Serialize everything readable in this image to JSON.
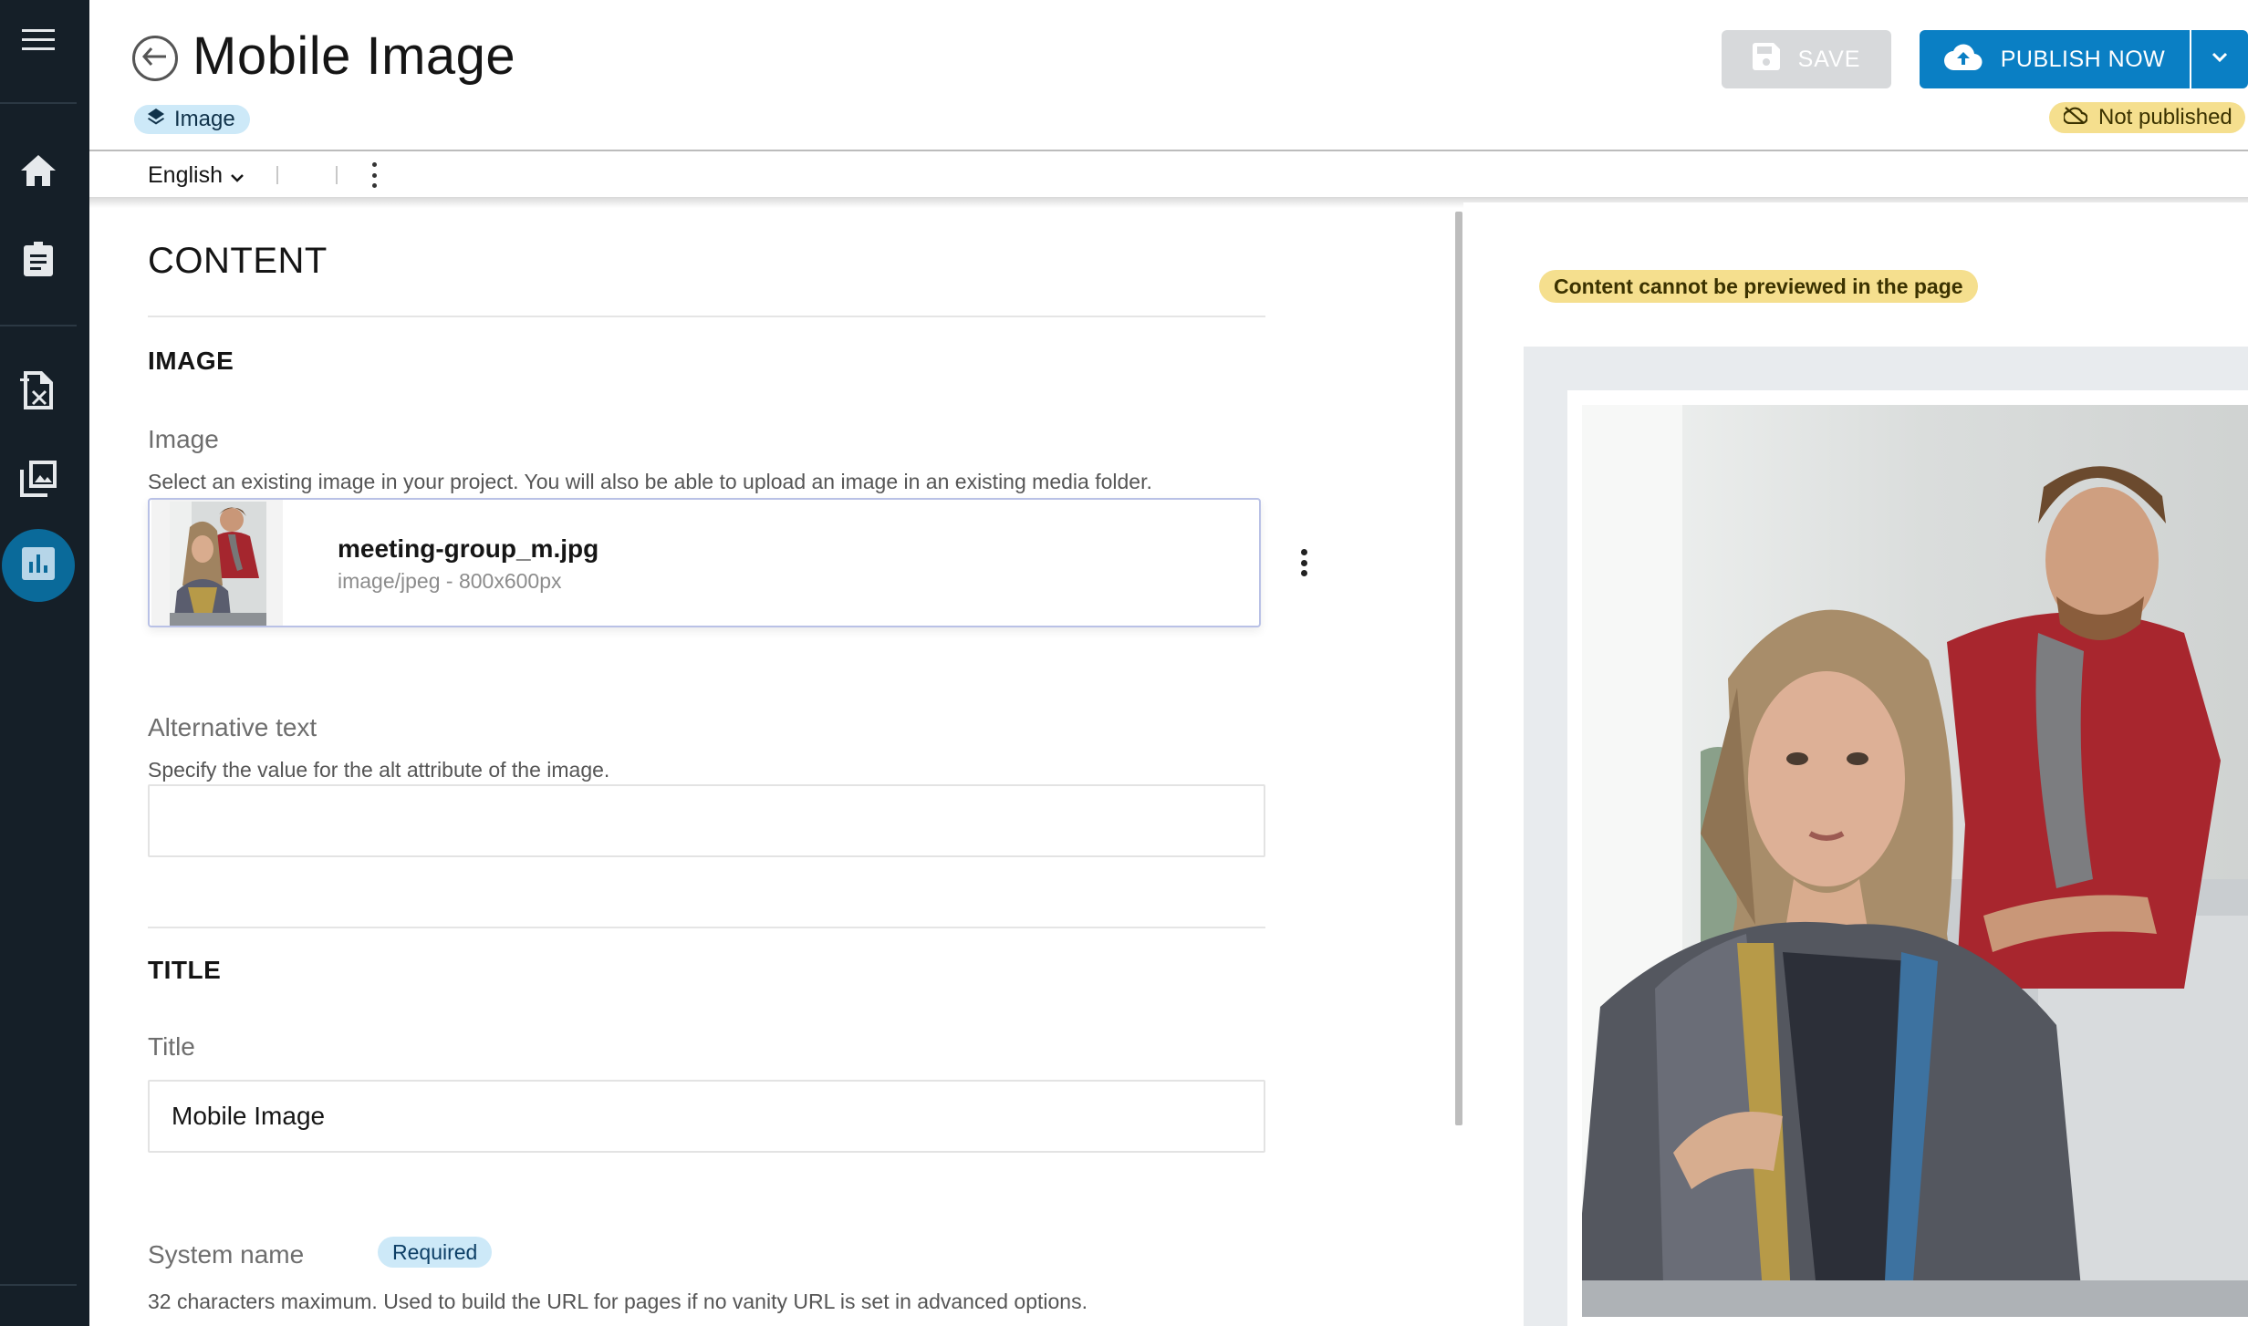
{
  "header": {
    "title": "Mobile Image",
    "type_badge": "Image",
    "save_label": "SAVE",
    "publish_label": "PUBLISH NOW",
    "status": "Not published"
  },
  "toolbar": {
    "language": "English"
  },
  "content": {
    "heading": "CONTENT",
    "image_section": {
      "title": "IMAGE",
      "field_label": "Image",
      "help": "Select an existing image in your project. You will also be able to upload an image in an existing media folder.",
      "asset": {
        "name": "meeting-group_m.jpg",
        "meta": "image/jpeg - 800x600px"
      }
    },
    "alt_text": {
      "label": "Alternative text",
      "help": "Specify the value for the alt attribute of the image.",
      "value": ""
    },
    "title_section": {
      "title": "TITLE",
      "field_label": "Title",
      "value": "Mobile Image"
    },
    "system_name": {
      "label": "System name",
      "badge": "Required",
      "help": "32 characters maximum. Used to build the URL for pages if no vanity URL is set in advanced options."
    }
  },
  "preview": {
    "note": "Content cannot be previewed in the page"
  },
  "icons": {
    "sidebar": [
      "menu-icon",
      "home-icon",
      "clipboard-icon",
      "content-file-icon",
      "media-library-icon",
      "analytics-icon"
    ],
    "header": [
      "back-arrow-icon",
      "layers-icon",
      "save-icon",
      "cloud-upload-icon",
      "chevron-down-icon",
      "cloud-off-icon"
    ]
  },
  "colors": {
    "sidebar_bg": "#151f28",
    "sidebar_active": "#0a6a9a",
    "primary": "#0a7fc4",
    "badge_blue": "#cde9f8",
    "badge_yellow": "#f5df8e",
    "save_disabled": "#d7d9db"
  }
}
